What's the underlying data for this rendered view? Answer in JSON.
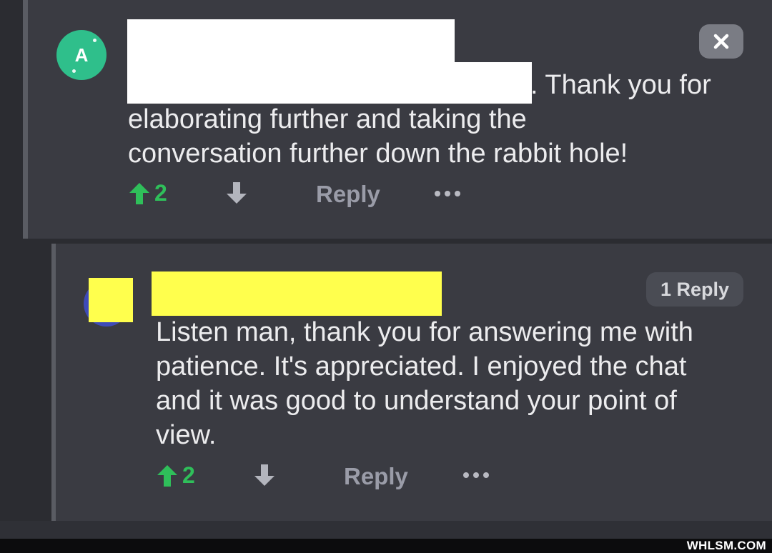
{
  "comments": [
    {
      "avatar_letter": "A",
      "text_first_line": ". Thank you for",
      "text_rest": "elaborating further and taking the\nconversation further down the rabbit hole!",
      "upvotes": "2",
      "reply_label": "Reply"
    },
    {
      "reply_count_label": "1 Reply",
      "text": "Listen man, thank you for answering me with\npatience. It's appreciated. I enjoyed the chat\nand it was good to understand your point of\nview.",
      "upvotes": "2",
      "reply_label": "Reply"
    }
  ],
  "watermark": "WHLSM.COM",
  "colors": {
    "background": "#2b2c31",
    "comment_bg": "#3a3b42",
    "upvote": "#2fbf5a",
    "avatar_a": "#2fbf8b",
    "redaction_yellow": "#ffff4d",
    "redaction_white": "#ffffff"
  },
  "icons": [
    "close-icon",
    "upvote-arrow-icon",
    "downvote-arrow-icon",
    "more-options-icon"
  ]
}
